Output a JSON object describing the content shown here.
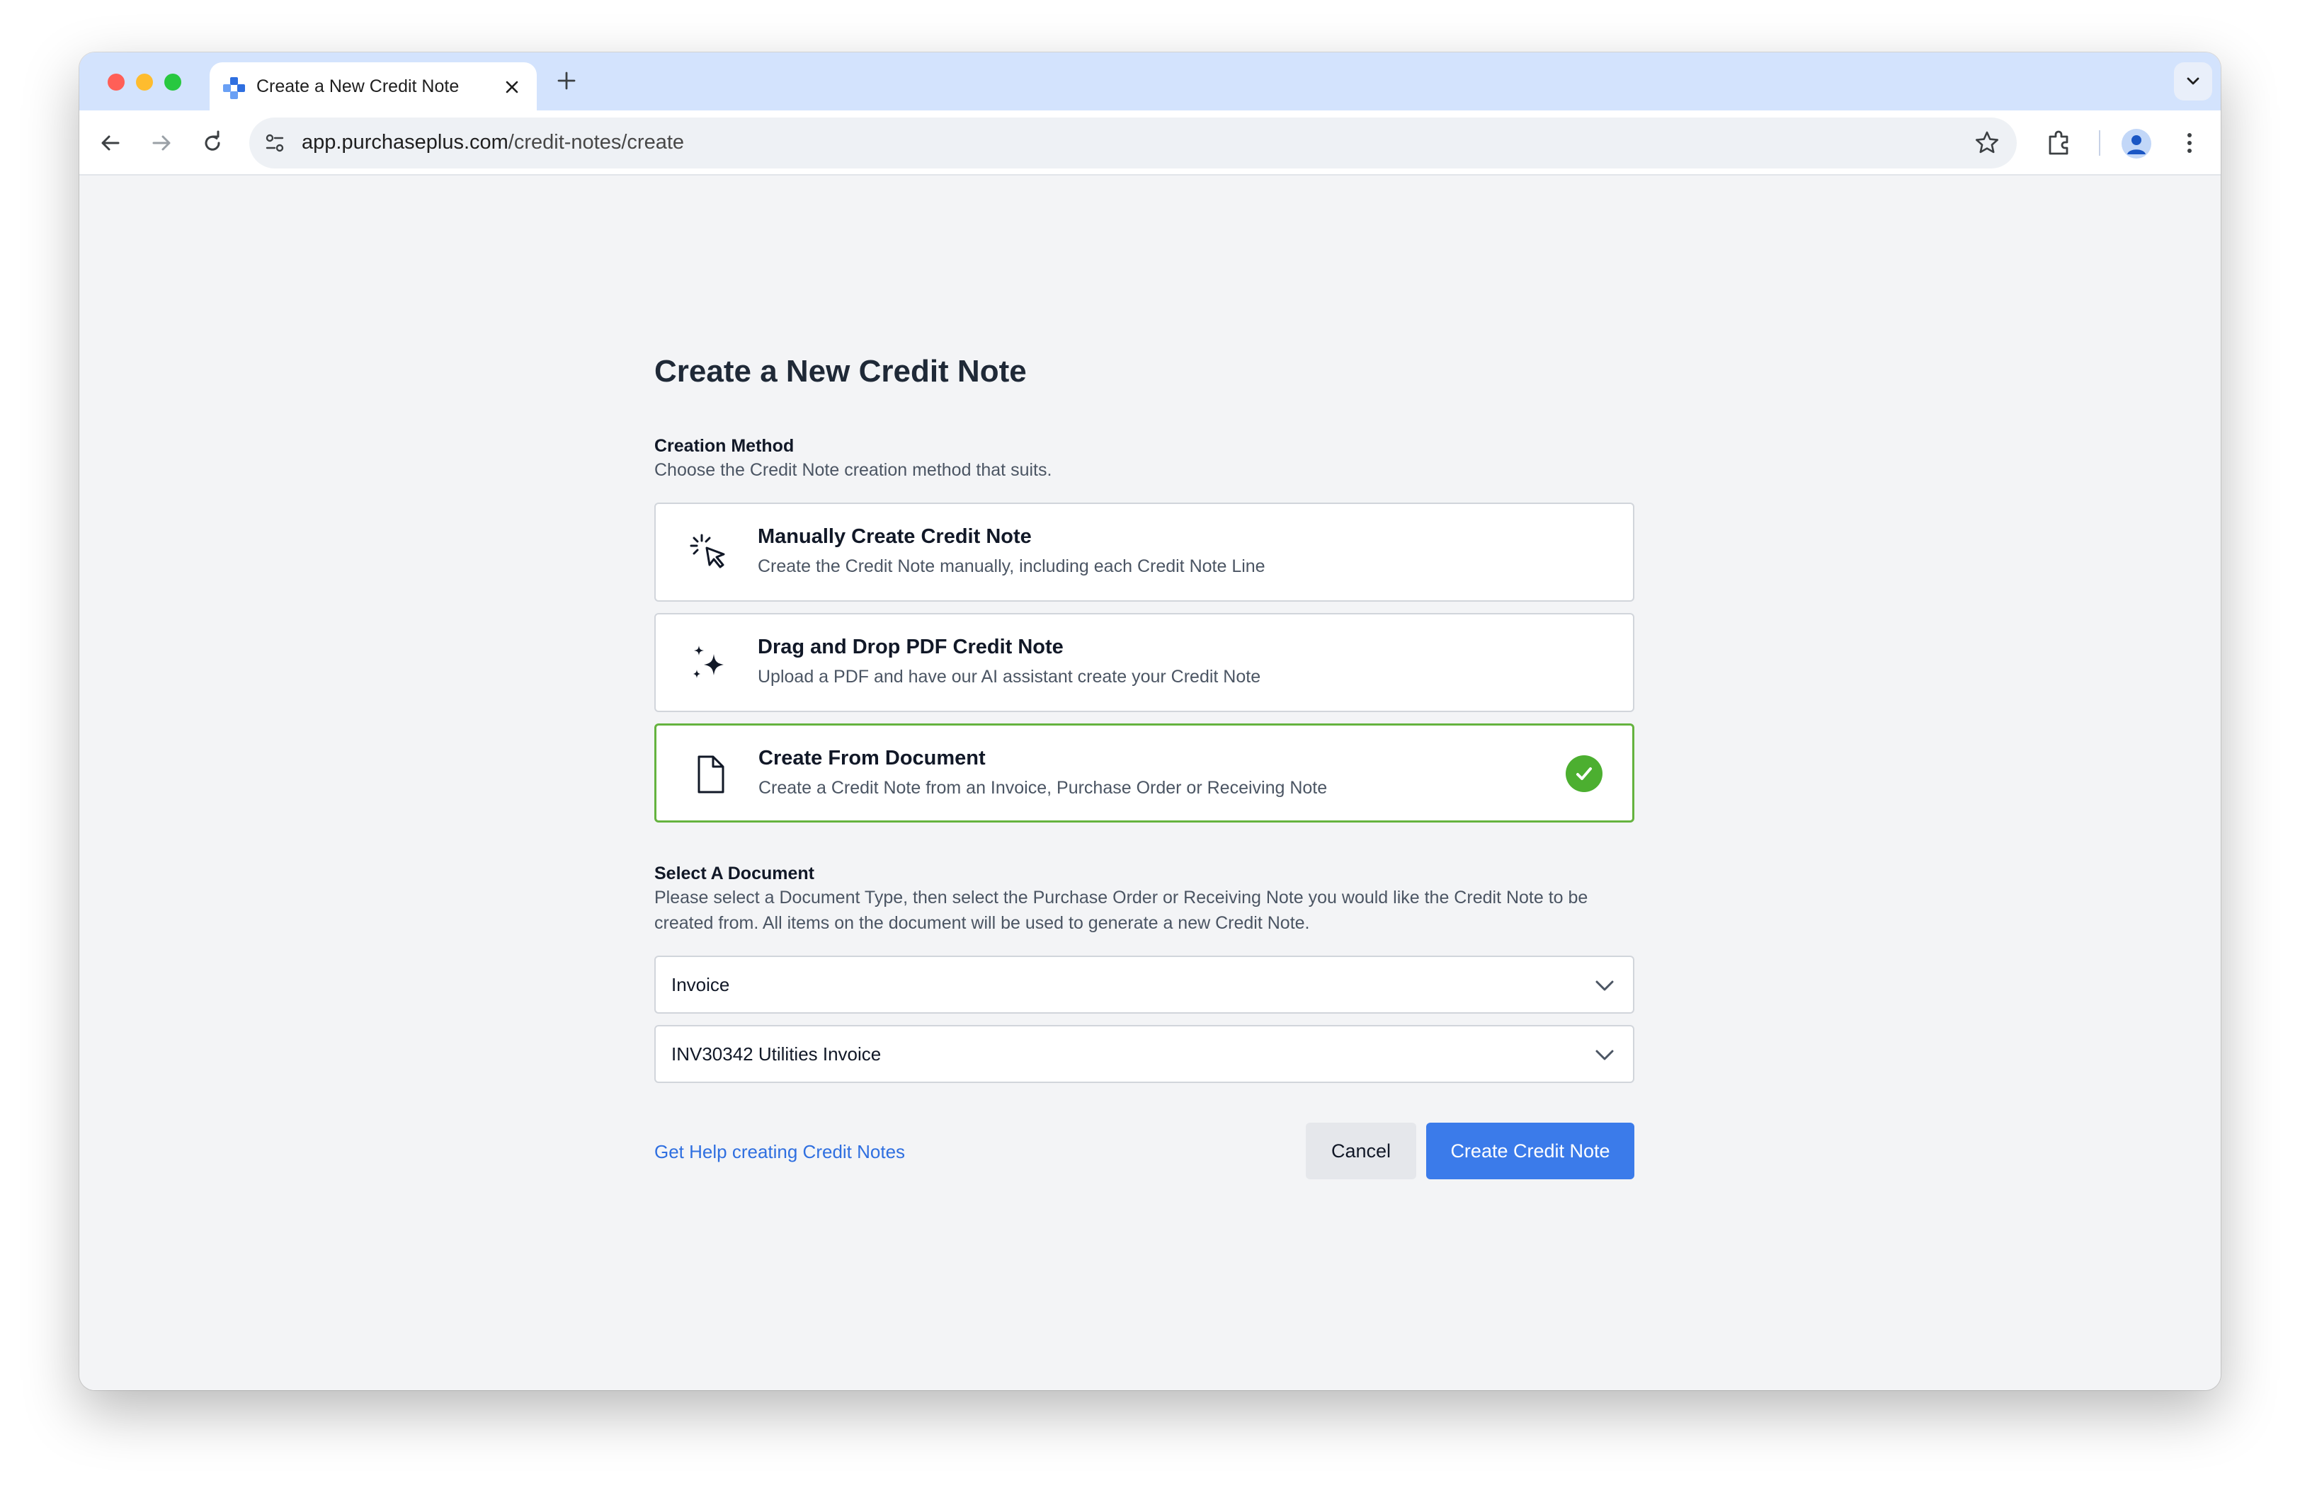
{
  "browser": {
    "tab_title": "Create a New Credit Note",
    "url_host": "app.purchaseplus.com",
    "url_path": "/credit-notes/create"
  },
  "page": {
    "title": "Create a New Credit Note",
    "creation_method": {
      "label": "Creation Method",
      "description": "Choose the Credit Note creation method that suits.",
      "options": [
        {
          "title": "Manually Create Credit Note",
          "description": "Create the Credit Note manually, including each Credit Note Line",
          "icon": "cursor-click-icon",
          "selected": false
        },
        {
          "title": "Drag and Drop PDF Credit Note",
          "description": "Upload a PDF and have our AI assistant create your Credit Note",
          "icon": "sparkles-icon",
          "selected": false
        },
        {
          "title": "Create From Document",
          "description": "Create a Credit Note from an Invoice, Purchase Order or Receiving Note",
          "icon": "document-icon",
          "selected": true
        }
      ]
    },
    "select_document": {
      "label": "Select A Document",
      "description": "Please select a Document Type, then select the Purchase Order or Receiving Note you would like the Credit Note to be created from. All items on the document will be used to generate a new Credit Note.",
      "document_type_value": "Invoice",
      "document_value": "INV30342 Utilities Invoice"
    },
    "help_link": "Get Help creating Credit Notes",
    "cancel_label": "Cancel",
    "create_label": "Create Credit Note"
  },
  "colors": {
    "primary": "#3b7bea",
    "selected_border": "#65b33f",
    "check": "#4caf30",
    "link": "#2f6fe0"
  }
}
